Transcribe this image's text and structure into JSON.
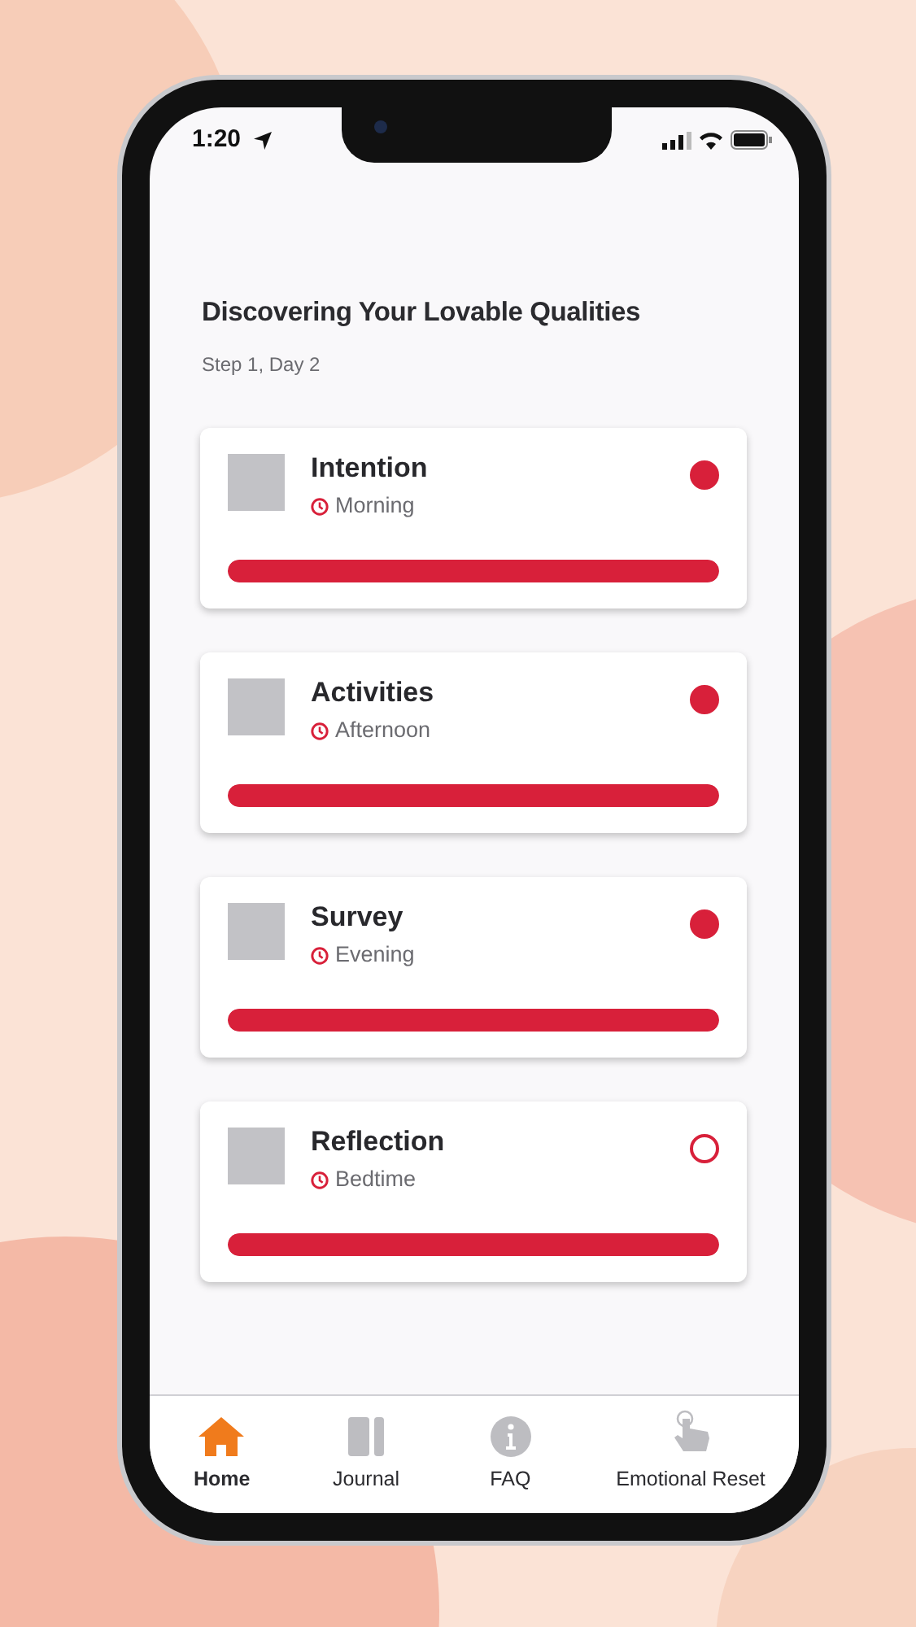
{
  "status_bar": {
    "time": "1:20"
  },
  "header": {
    "title": "Discovering Your  Lovable Qualities",
    "subtitle": "Step 1, Day 2"
  },
  "tasks": [
    {
      "title": "Intention",
      "time": "Morning",
      "done": true,
      "level": 1
    },
    {
      "title": "Activities",
      "time": "Afternoon",
      "done": true,
      "level": 1
    },
    {
      "title": "Survey",
      "time": "Evening",
      "done": true,
      "level": 1
    },
    {
      "title": "Reflection",
      "time": "Bedtime",
      "done": false,
      "level": 1
    }
  ],
  "tab_bar": [
    {
      "label": "Home",
      "kind": "home",
      "selected": true
    },
    {
      "label": "Journal",
      "kind": "journal",
      "selected": false
    },
    {
      "label": "FAQ",
      "kind": "info",
      "selected": false
    },
    {
      "label": "Emotional Reset",
      "kind": "touch",
      "selected": false
    }
  ]
}
